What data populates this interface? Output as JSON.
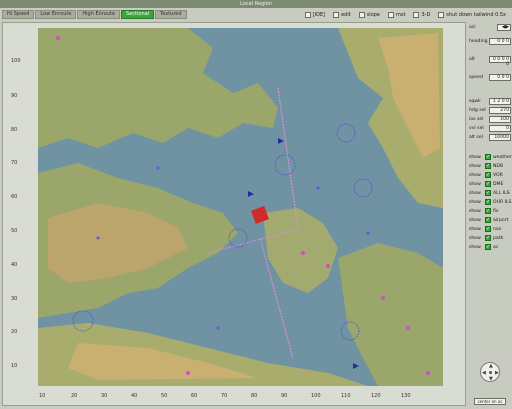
{
  "window": {
    "title": "Local Region"
  },
  "tabs": [
    {
      "label": "Hi Speed"
    },
    {
      "label": "Low Enroute"
    },
    {
      "label": "High Enroute"
    },
    {
      "label": "Sectional"
    },
    {
      "label": "Textured"
    }
  ],
  "active_tab": 3,
  "toolbar": [
    {
      "label": "[IDE]"
    },
    {
      "label": "edit"
    },
    {
      "label": "slope"
    },
    {
      "label": "mst"
    },
    {
      "label": "3-D"
    },
    {
      "label": "shut down tailwind 0.5x"
    }
  ],
  "panel": {
    "ac_label": "a/c",
    "heading_label": "heading",
    "heading_value": "0 0 0",
    "alt_label": "alt",
    "alt_value": "0 0 0 0 0",
    "speed_label": "speed",
    "speed_value": "0 0 0",
    "sq_label": "sqwk",
    "sq_value": "1 2 0 0",
    "hdg_label": "hdg sel",
    "hdg_value": "270",
    "ias_label": "ias sel",
    "ias_value": "100",
    "vvi_label": "vvi sel",
    "vvi_value": "0",
    "altsel_label": "alt sel",
    "altsel_value": "10000",
    "show_label": "show",
    "show_items": [
      "weather",
      "NDB",
      "VOR",
      "DME",
      "ALL ILS",
      "OUR ILS",
      "fix",
      "airport",
      "nav",
      "path",
      "ac"
    ],
    "center_button": "center on ac"
  },
  "axes": {
    "y_ticks": [
      "100",
      "90",
      "80",
      "70",
      "60",
      "50",
      "40",
      "30",
      "20",
      "10"
    ],
    "x_ticks": [
      "10",
      "20",
      "30",
      "40",
      "50",
      "60",
      "70",
      "80",
      "90",
      "100",
      "110",
      "120",
      "130"
    ]
  },
  "colors": {
    "water": "#6f93a3",
    "land": "#9aa66a",
    "highland": "#c9b070",
    "accent": "#3aa53a"
  }
}
